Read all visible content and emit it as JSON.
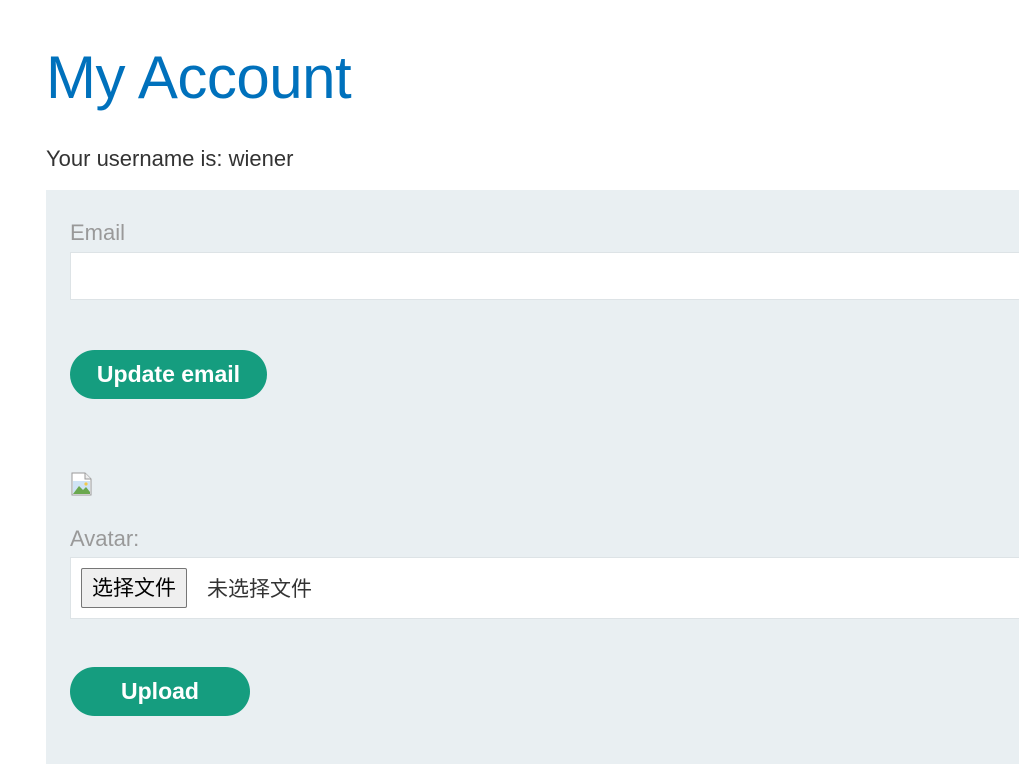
{
  "page": {
    "title": "My Account",
    "username_text": "Your username is: wiener"
  },
  "email_form": {
    "label": "Email",
    "value": "",
    "placeholder": "",
    "submit_label": "Update email"
  },
  "avatar_form": {
    "image_icon": "broken-image-icon",
    "label": "Avatar:",
    "choose_button_label": "选择文件",
    "file_status": "未选择文件",
    "submit_label": "Upload"
  },
  "colors": {
    "title": "#0071bc",
    "button": "#159d7f",
    "panel": "#e9eff2",
    "label": "#999999"
  }
}
